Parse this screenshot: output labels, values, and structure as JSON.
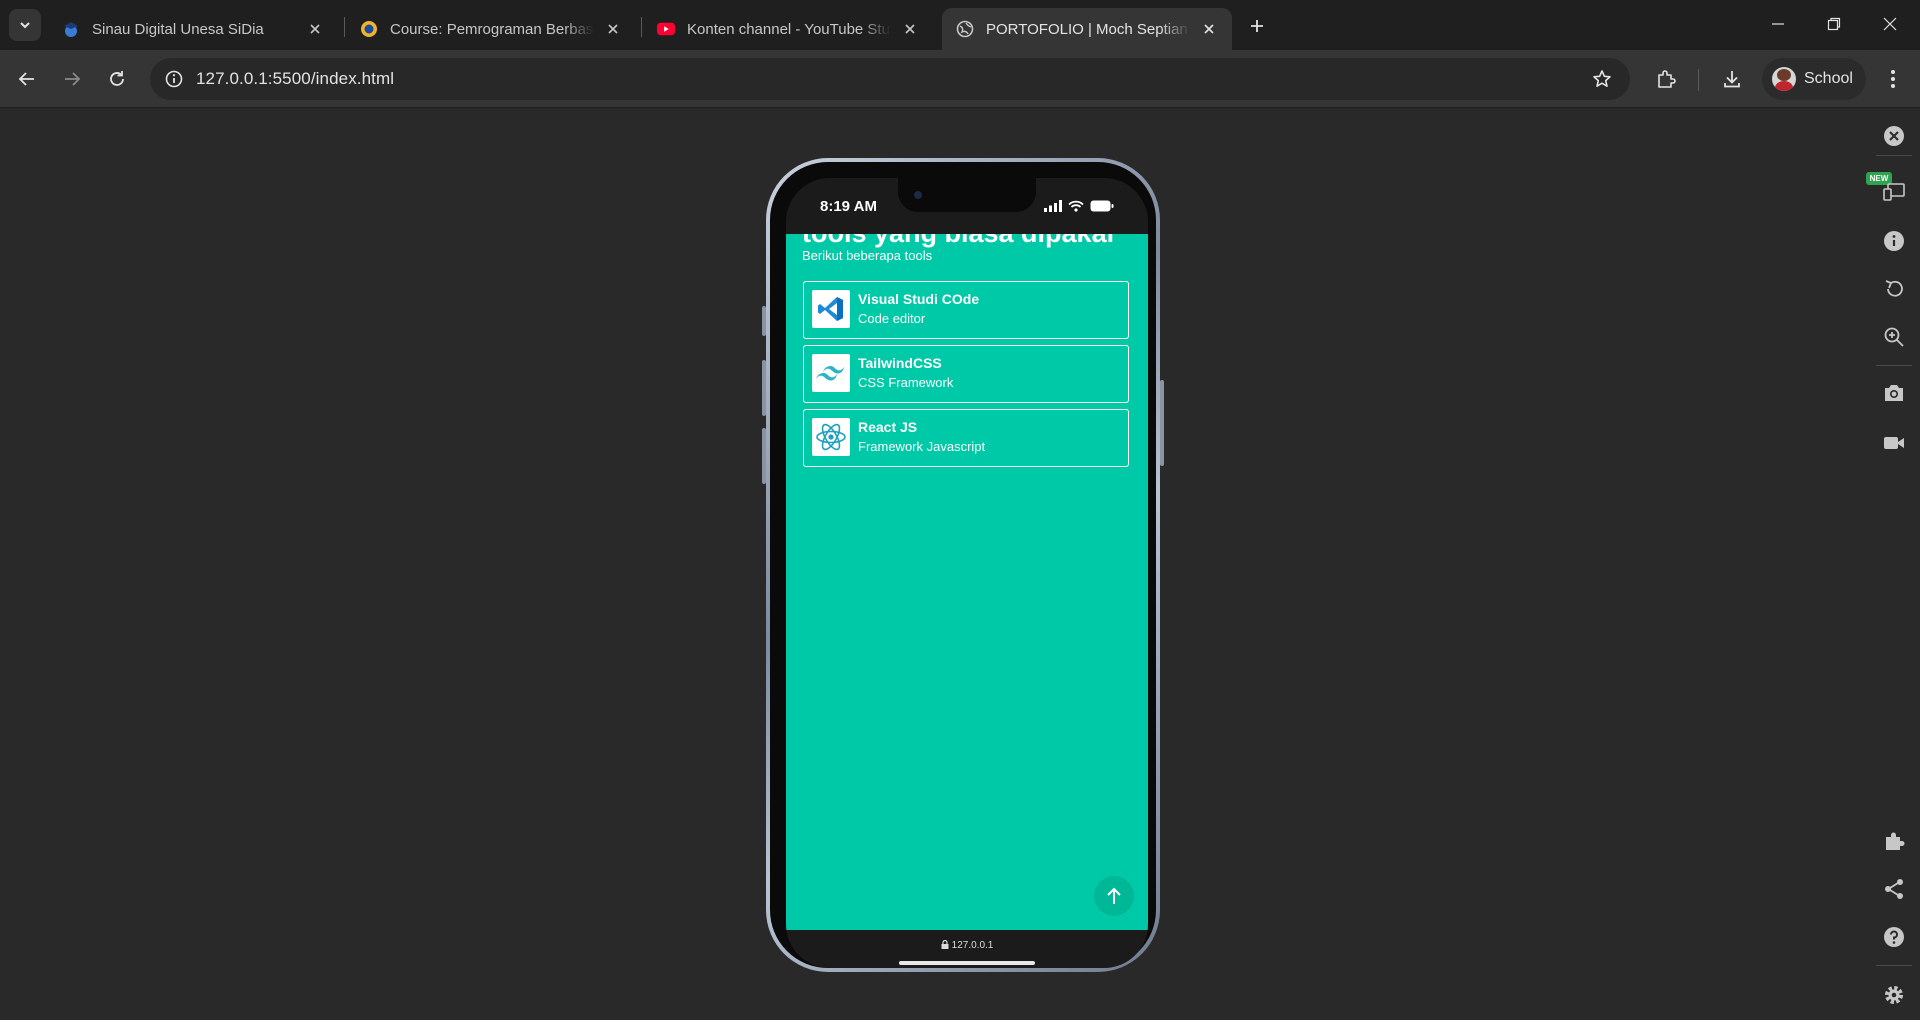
{
  "browser": {
    "tabs": [
      {
        "title": "Sinau Digital Unesa SiDia",
        "favicon": "sidia-hat-icon",
        "active": false
      },
      {
        "title": "Course: Pemrograman Berbasis",
        "favicon": "unesa-logo-icon",
        "active": false
      },
      {
        "title": "Konten channel - YouTube Studio",
        "favicon": "youtube-icon",
        "active": false
      },
      {
        "title": "PORTOFOLIO | Moch Septian Yu",
        "favicon": "globe-icon",
        "active": true
      }
    ],
    "url": "127.0.0.1:5500/index.html",
    "profile_label": "School",
    "new_badge": "NEW"
  },
  "phone": {
    "time": "8:19 AM",
    "heading": "tools yang biasa dipakai",
    "subheading": "Berikut beberapa tools",
    "tools": [
      {
        "name": "Visual Studi COde",
        "desc": "Code editor",
        "logo": "vscode-logo-icon"
      },
      {
        "name": "TailwindCSS",
        "desc": "CSS Framework",
        "logo": "tailwind-logo-icon"
      },
      {
        "name": "React JS",
        "desc": "Framework Javascript",
        "logo": "react-logo-icon"
      }
    ],
    "page_url": "127.0.0.1",
    "accent_color": "#00c9a7"
  }
}
